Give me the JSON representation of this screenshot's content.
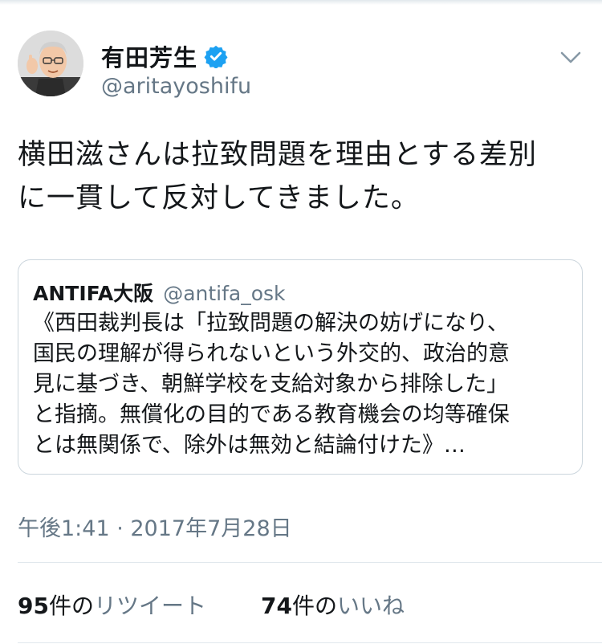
{
  "user": {
    "display_name": "有田芳生",
    "handle": "@aritayoshifu",
    "verified": true
  },
  "tweet": {
    "lines": [
      "横田滋さんは拉致問題を理由とする差別",
      "に一貫して反対してきました。"
    ]
  },
  "quote": {
    "name": "ANTIFA大阪",
    "handle": "@antifa_osk",
    "lines": [
      "《西田裁判長は「拉致問題の解決の妨げになり、",
      "国民の理解が得られないという外交的、政治的意",
      "見に基づき、朝鮮学校を支給対象から排除した」",
      "と指摘。無償化の目的である教育機会の均等確保",
      "とは無関係で、除外は無効と結論付けた》…"
    ]
  },
  "timestamp": "午後1:41 · 2017年7月28日",
  "stats": {
    "retweets": {
      "count": "95",
      "unit": "件の",
      "label": "リツイート"
    },
    "likes": {
      "count": "74",
      "unit": "件の",
      "label": "いいね"
    }
  },
  "colors": {
    "text": "#14171a",
    "secondary": "#657786",
    "verified": "#1da1f2",
    "border": "#ccd6dd"
  },
  "icons": {
    "verified": "verified-badge-icon",
    "menu": "chevron-down-icon"
  }
}
